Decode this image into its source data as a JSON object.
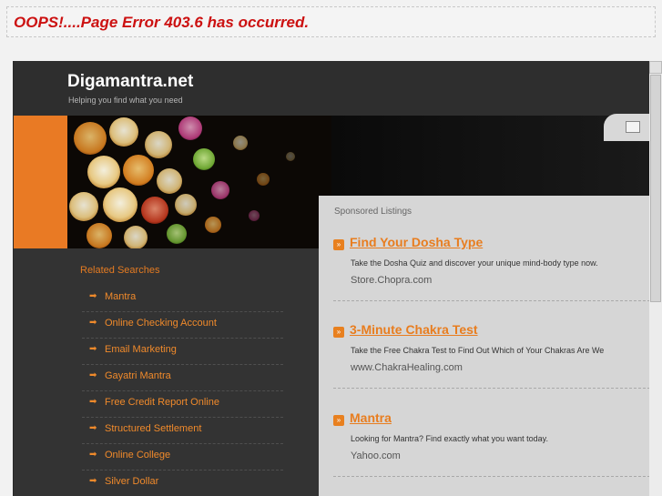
{
  "error": {
    "message": "OOPS!....Page Error 403.6 has occurred."
  },
  "site": {
    "title": "Digamantra.net",
    "tagline": "Helping you find what you need"
  },
  "colors": {
    "accent": "#e97a24",
    "link": "#f08a2b",
    "error": "#cc1111"
  },
  "related": {
    "title": "Related Searches",
    "arrow_icon": "➡",
    "items": [
      {
        "label": "Mantra"
      },
      {
        "label": "Online Checking Account"
      },
      {
        "label": "Email Marketing"
      },
      {
        "label": "Gayatri Mantra"
      },
      {
        "label": "Free Credit Report Online"
      },
      {
        "label": "Structured Settlement"
      },
      {
        "label": "Online College"
      },
      {
        "label": "Silver Dollar"
      }
    ]
  },
  "sponsored": {
    "title": "Sponsored Listings",
    "badge_icon": "»",
    "ads": [
      {
        "headline": "Find Your Dosha Type",
        "description": "Take the Dosha Quiz and discover your unique mind-body type now.",
        "url": "Store.Chopra.com"
      },
      {
        "headline": "3-Minute Chakra Test",
        "description": "Take the Free Chakra Test to Find Out Which of Your Chakras Are We",
        "url": "www.ChakraHealing.com"
      },
      {
        "headline": "Mantra",
        "description": "Looking for Mantra? Find exactly what you want today.",
        "url": "Yahoo.com"
      }
    ]
  }
}
